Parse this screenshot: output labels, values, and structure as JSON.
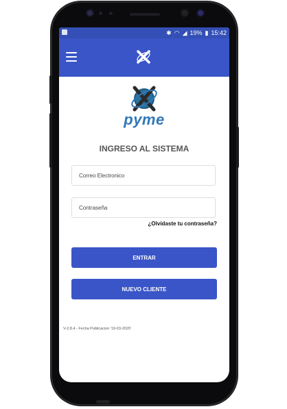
{
  "status_bar": {
    "battery_percent": "19%",
    "time": "15:42",
    "icons": [
      "bluetooth-icon",
      "wifi-icon",
      "signal-icon",
      "battery-icon"
    ]
  },
  "app_bar": {
    "menu_icon": "menu-icon",
    "logo_icon": "brand-logo-icon"
  },
  "brand": {
    "name": "pyme",
    "primary_color": "#3a55c7",
    "logo_color": "#2f77b8"
  },
  "login": {
    "title": "INGRESO AL SISTEMA",
    "email_placeholder": "Correo Electronico",
    "password_placeholder": "Contraseña",
    "forgot_password": "¿Olvidaste tu contraseña?",
    "login_button": "ENTRAR",
    "new_client_button": "NUEVO CLIENTE"
  },
  "footer": {
    "version_text": "V-2.8.4 - Fecha Publicacion '19-03-2020'"
  }
}
